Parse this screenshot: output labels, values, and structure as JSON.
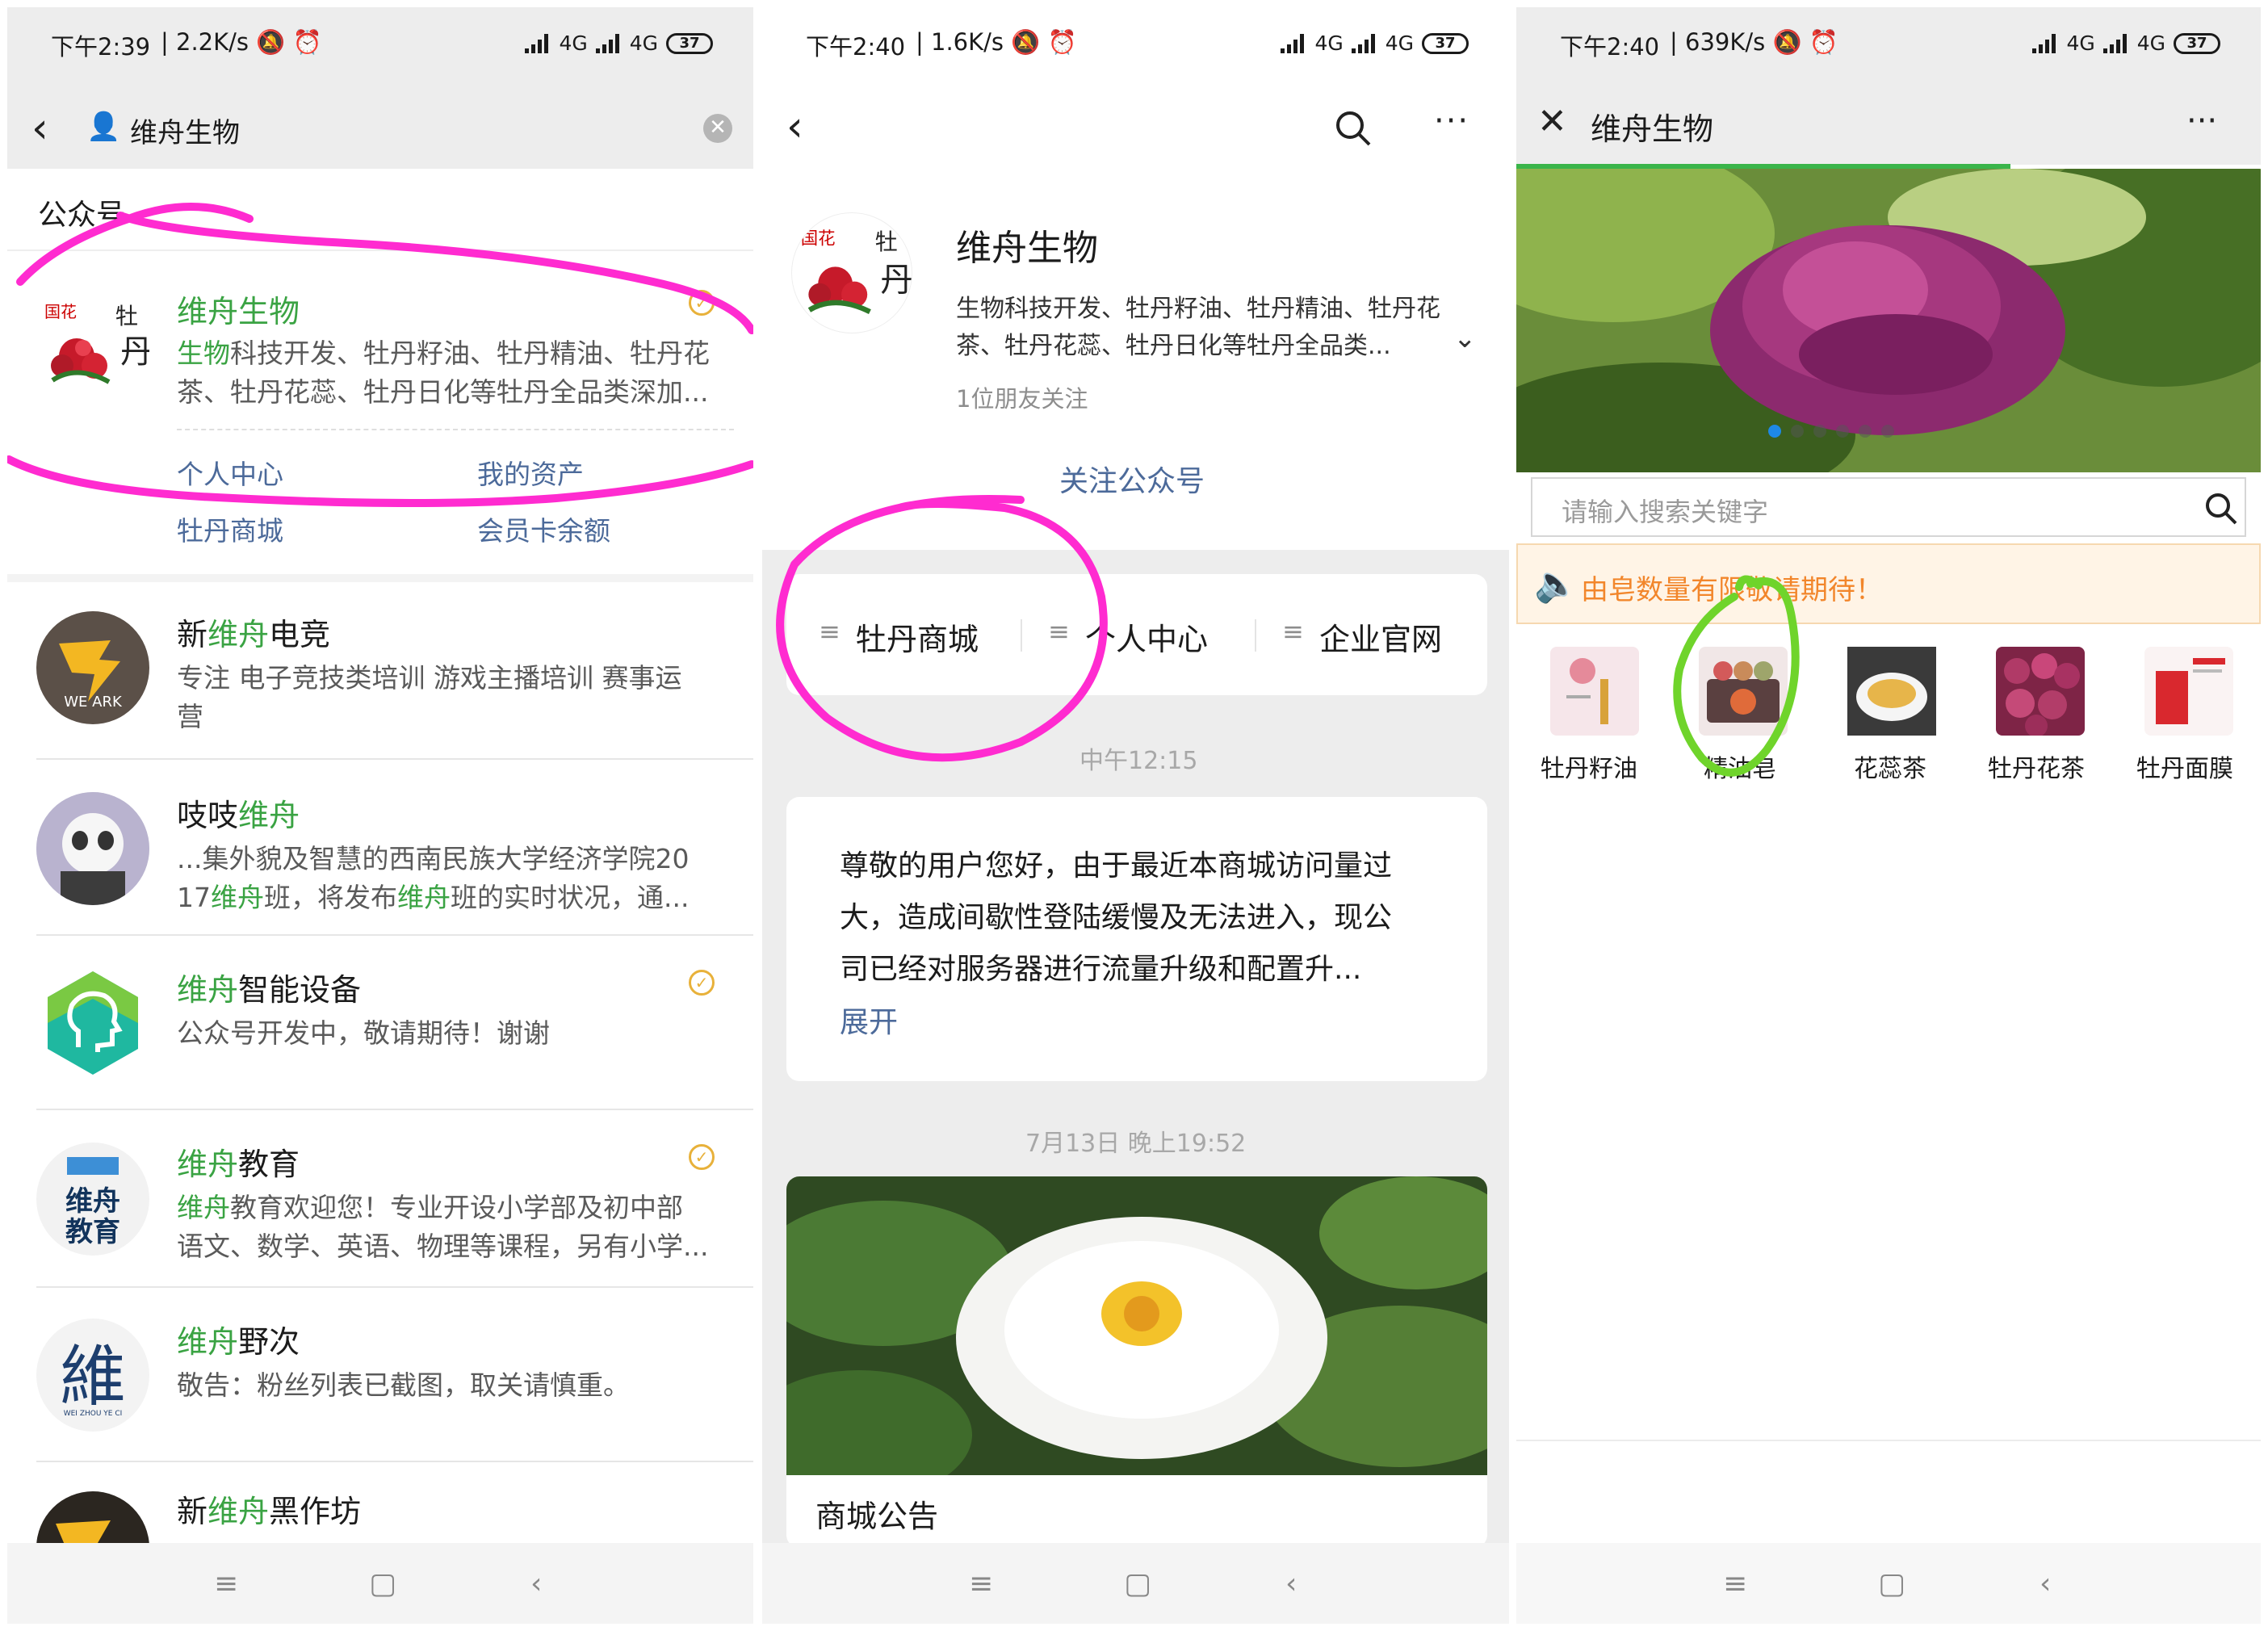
{
  "panel1": {
    "status": {
      "time": "下午2:39",
      "speed": "2.2K/s",
      "network": "4G",
      "battery": "37"
    },
    "search": {
      "value": "维舟生物"
    },
    "section_title": "公众号",
    "results": [
      {
        "name_pre": "",
        "name_hl": "维舟生物",
        "name_post": "",
        "desc_line1_hl": "生物",
        "desc_line1": "科技开发、牡丹籽油、牡丹精油、牡丹花",
        "desc_line2": "茶、牡丹花蕊、牡丹日化等牡丹全品类深加...",
        "menus": [
          "个人中心",
          "我的资产",
          "牡丹商城",
          "会员卡余额"
        ],
        "avatar": "peony-logo"
      },
      {
        "name_pre": "新",
        "name_hl": "维舟",
        "name_post": "电竞",
        "desc_line1": "专注 电子竞技类培训  游戏主播培训  赛事运",
        "desc_line2": "营",
        "avatar_text": "WE ARK"
      },
      {
        "name_pre": "吱吱",
        "name_hl": "维舟",
        "name_post": "",
        "desc_line1": "...集外貌及智慧的西南民族大学经济学院20",
        "desc_line2_a": "17",
        "desc_line2_hl1": "维舟",
        "desc_line2_b": "班，将发布",
        "desc_line2_hl2": "维舟",
        "desc_line2_c": "班的实时状况，通..."
      },
      {
        "name_pre": "",
        "name_hl": "维舟",
        "name_post": "智能设备",
        "desc_line1": "公众号开发中，敬请期待！谢谢"
      },
      {
        "name_pre": "",
        "name_hl": "维舟",
        "name_post": "教育",
        "desc_line1_hl": "维舟",
        "desc_line1": "教育欢迎您！专业开设小学部及初中部",
        "desc_line2": "语文、数学、英语、物理等课程，另有小学...",
        "avatar_text": "维舟教育"
      },
      {
        "name_pre": "",
        "name_hl": "维舟",
        "name_post": "野次",
        "desc_line1": "敬告：粉丝列表已截图，取关请慎重。",
        "avatar_text": "維",
        "avatar_sub": "WEI ZHOU YE CI"
      },
      {
        "name_pre": "新",
        "name_hl": "维舟",
        "name_post": "黑作坊"
      }
    ]
  },
  "panel2": {
    "status": {
      "time": "下午2:40",
      "speed": "1.6K/s",
      "network": "4G",
      "battery": "37"
    },
    "account": {
      "name": "维舟生物",
      "desc_line1": "生物科技开发、牡丹籽油、牡丹精油、牡丹花",
      "desc_line2": "茶、牡丹花蕊、牡丹日化等牡丹全品类...",
      "followers": "1位朋友关注",
      "follow_label": "关注公众号"
    },
    "menu": [
      "牡丹商城",
      "个人中心",
      "企业官网"
    ],
    "time1": "中午12:15",
    "message": {
      "line1": "尊敬的用户您好，由于最近本商城访问量过",
      "line2": "大，造成间歇性登陆缓慢及无法进入，现公",
      "line3": "司已经对服务器进行流量升级和配置升...",
      "expand": "展开"
    },
    "time2": "7月13日 晚上19:52",
    "article_title": "商城公告"
  },
  "panel3": {
    "status": {
      "time": "下午2:40",
      "speed": "639K/s",
      "network": "4G",
      "battery": "37"
    },
    "title": "维舟生物",
    "search_placeholder": "请输入搜索关键字",
    "notice": "由皂数量有限敬请期待！",
    "categories": [
      {
        "label": "牡丹籽油",
        "color": "#f4dbe0"
      },
      {
        "label": "精油皂",
        "color": "#6b4a4a"
      },
      {
        "label": "花蕊茶",
        "color": "#e0b76a"
      },
      {
        "label": "牡丹花茶",
        "color": "#9a2a53"
      },
      {
        "label": "牡丹面膜",
        "color": "#e6414d"
      }
    ]
  },
  "colors": {
    "wechat_green": "#3aa343",
    "link_blue": "#4c6a9a",
    "annotation_pink": "#ff2bd0",
    "annotation_green": "#6fd42b",
    "notice_orange": "#f2862b"
  }
}
